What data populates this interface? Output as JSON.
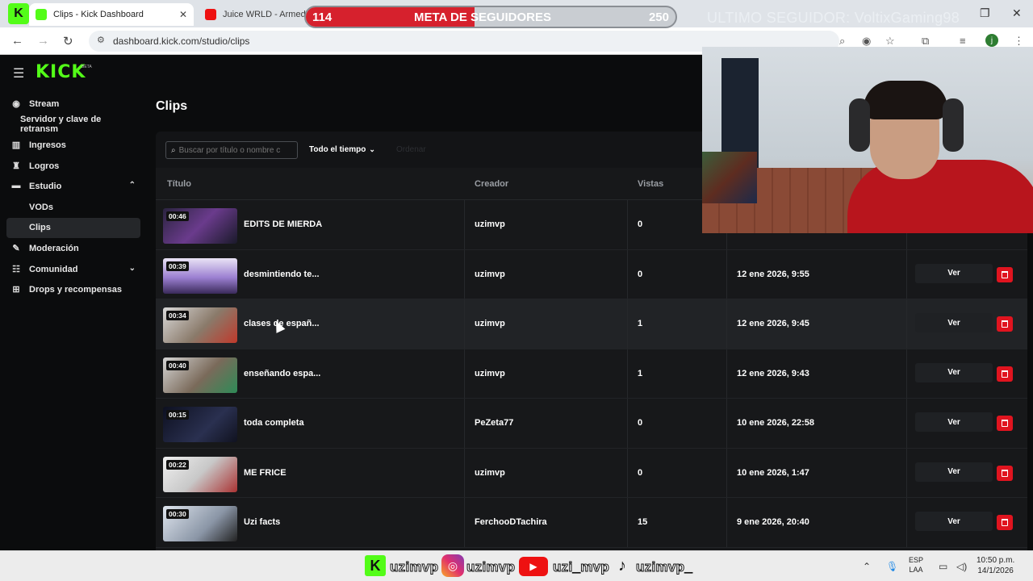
{
  "browser": {
    "tabs": [
      {
        "title": "Clips - Kick Dashboard",
        "active": true
      },
      {
        "title": "Juice WRLD - Armed (",
        "active": false
      }
    ],
    "url": "dashboard.kick.com/studio/clips",
    "profile_initial": "j"
  },
  "overlay": {
    "goal_current": "114",
    "goal_label": "META DE SEGUIDORES",
    "goal_target": "250",
    "goal_fraction": 0.456,
    "last_follower": "ULTIMO SEGUIDOR: VoltixGaming98"
  },
  "app": {
    "logo": "KICK",
    "logo_badge": "BETA",
    "accent_color": "#53fc18"
  },
  "sidebar": {
    "items": [
      {
        "label": "Stream",
        "icon": "broadcast-icon"
      },
      {
        "label": "Servidor y clave de retransm",
        "icon": ""
      },
      {
        "label": "Ingresos",
        "icon": "chart-icon"
      },
      {
        "label": "Logros",
        "icon": "trophy-icon"
      },
      {
        "label": "Estudio",
        "icon": "studio-icon"
      },
      {
        "label": "VODs",
        "icon": ""
      },
      {
        "label": "Clips",
        "icon": ""
      },
      {
        "label": "Moderación",
        "icon": "wrench-icon"
      },
      {
        "label": "Comunidad",
        "icon": "community-icon"
      },
      {
        "label": "Drops y recompensas",
        "icon": "gift-icon"
      }
    ]
  },
  "main": {
    "title": "Clips",
    "search_placeholder": "Buscar por título o nombre c",
    "time_filter": "Todo el tiempo",
    "dim_filter": "Ordenar",
    "columns": {
      "title": "Título",
      "creator": "Creador",
      "views": "Vistas"
    },
    "view_label": "Ver",
    "clips": [
      {
        "duration": "00:46",
        "title": "EDITS DE MIERDA",
        "creator": "uzimvp",
        "views": "0",
        "date": ""
      },
      {
        "duration": "00:39",
        "title": "desmintiendo te...",
        "creator": "uzimvp",
        "views": "0",
        "date": "12 ene 2026, 9:55"
      },
      {
        "duration": "00:34",
        "title": "clases de españ...",
        "creator": "uzimvp",
        "views": "1",
        "date": "12 ene 2026, 9:45"
      },
      {
        "duration": "00:40",
        "title": "enseñando espa...",
        "creator": "uzimvp",
        "views": "1",
        "date": "12 ene 2026, 9:43"
      },
      {
        "duration": "00:15",
        "title": "toda completa",
        "creator": "PeZeta77",
        "views": "0",
        "date": "10 ene 2026, 22:58"
      },
      {
        "duration": "00:22",
        "title": "ME FRICE",
        "creator": "uzimvp",
        "views": "0",
        "date": "10 ene 2026, 1:47"
      },
      {
        "duration": "00:30",
        "title": "Uzi facts",
        "creator": "FerchooDTachira",
        "views": "15",
        "date": "9 ene 2026, 20:40"
      }
    ]
  },
  "taskbar": {
    "handles": [
      "uzimvp",
      "uzimvp",
      "uzi_mvp",
      "uzimvp_"
    ],
    "lang_top": "ESP",
    "lang_bottom": "LAA",
    "time": "10:50 p.m.",
    "date": "14/1/2026"
  }
}
